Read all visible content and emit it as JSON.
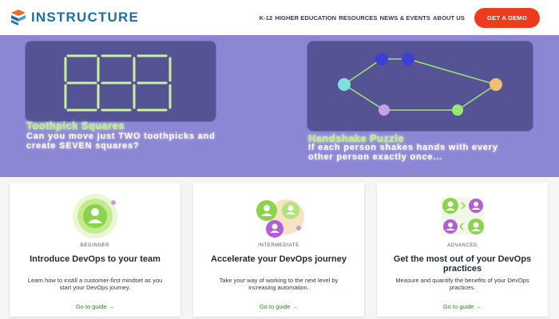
{
  "header": {
    "logo_text": "INSTRUCTURE",
    "nav": [
      "K-12",
      "HIGHER EDUCATION",
      "RESOURCES",
      "NEWS & EVENTS",
      "ABOUT US"
    ],
    "cta_label": "GET A DEMO",
    "colors": {
      "logo": "#1d6fa5",
      "cta": "#ec3b1d"
    }
  },
  "hero": {
    "background": "#8c87d4",
    "puzzles": [
      {
        "title": "Toothpick Squares",
        "description": "Can you move just TWO toothpicks and create SEVEN squares?"
      },
      {
        "title": "Handshake Puzzle",
        "description": "If each person shakes hands with every other person exactly once..."
      }
    ]
  },
  "cards": [
    {
      "level": "BEGINNER",
      "title": "Introduce DevOps to your team",
      "description": "Learn how to instill a customer-first mindset as you start your DevOps journey.",
      "link": "Go to guide →"
    },
    {
      "level": "INTERMEDIATE",
      "title": "Accelerate your DevOps journey",
      "description": "Take your way of working to the next level by increasing automation.",
      "link": "Go to guide →"
    },
    {
      "level": "ADVANCED",
      "title": "Get the most out of your DevOps practices",
      "description": "Measure and quantify the benefits of your DevOps practices.",
      "link": "Go to guide →"
    }
  ]
}
